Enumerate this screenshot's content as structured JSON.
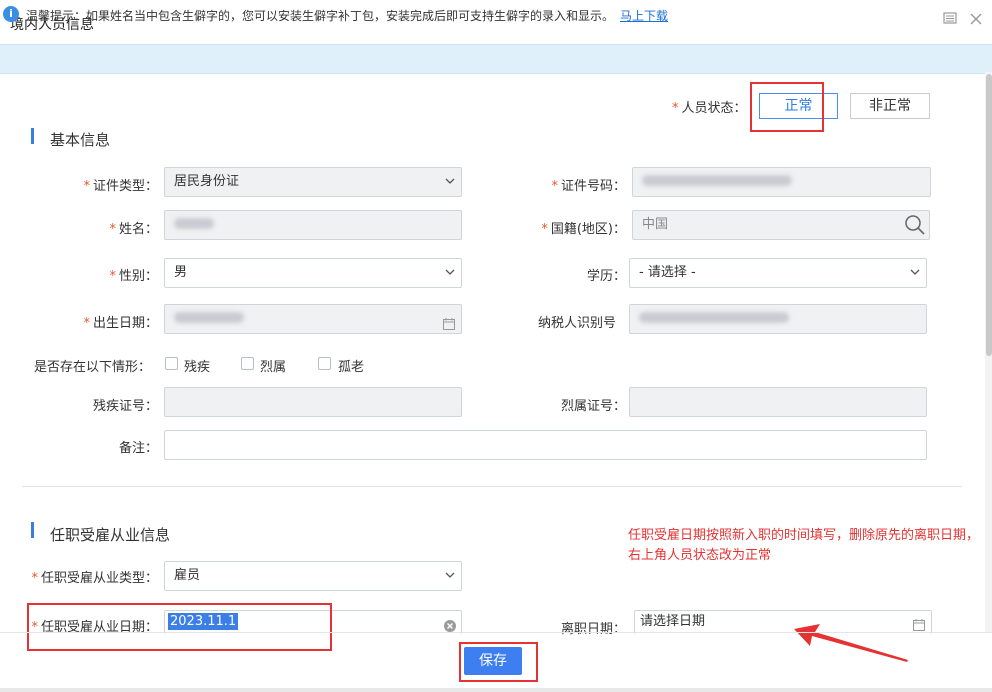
{
  "window": {
    "title": "境内人员信息"
  },
  "notice": {
    "text": "温馨提示：如果姓名当中包含生僻字的，您可以安装生僻字补丁包，安装完成后即可支持生僻字的录入和显示。",
    "link": "马上下载"
  },
  "status": {
    "label": "人员状态：",
    "normal": "正常",
    "abnormal": "非正常"
  },
  "basic": {
    "title": "基本信息",
    "id_type_label": "证件类型：",
    "id_type_value": "居民身份证",
    "id_no_label": "证件号码：",
    "name_label": "姓名：",
    "nationality_label": "国籍(地区)：",
    "nationality_value": "中国",
    "gender_label": "性别：",
    "gender_value": "男",
    "education_label": "学历：",
    "education_value": "- 请选择 -",
    "birth_label": "出生日期：",
    "tax_id_label": "纳税人识别号",
    "situation_label": "是否存在以下情形：",
    "opt_disabled": "残疾",
    "opt_martyr": "烈属",
    "opt_elderly": "孤老",
    "disabled_no_label": "残疾证号：",
    "martyr_no_label": "烈属证号：",
    "remark_label": "备注："
  },
  "employment": {
    "title": "任职受雇从业信息",
    "type_label": "任职受雇从业类型：",
    "type_value": "雇员",
    "date_label": "任职受雇从业日期：",
    "date_value": "2023.11.1",
    "leave_label": "离职日期：",
    "leave_placeholder": "请选择日期"
  },
  "annotation": {
    "line1": "任职受雇日期按照新入职的时间填写，删除原先的离职日期，",
    "line2": "右上角人员状态改为正常"
  },
  "footer": {
    "save": "保存"
  },
  "colors": {
    "accent": "#3d7ef0",
    "required": "#e8562a",
    "annotation": "#e53232"
  }
}
